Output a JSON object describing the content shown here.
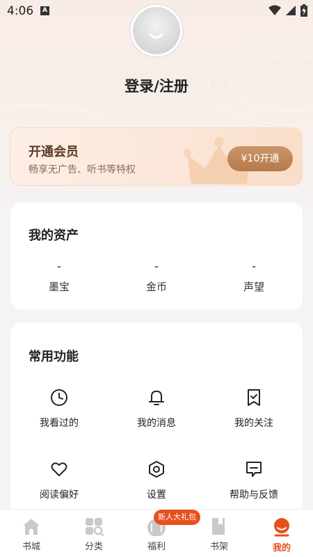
{
  "status_bar": {
    "time": "4:06",
    "notification_icon": "A"
  },
  "profile": {
    "login_label": "登录/注册"
  },
  "vip": {
    "title": "开通会员",
    "subtitle": "畅享无广告、听书等特权",
    "button_label": "¥10开通"
  },
  "assets": {
    "title": "我的资产",
    "items": [
      {
        "value": "-",
        "label": "墨宝"
      },
      {
        "value": "-",
        "label": "金币"
      },
      {
        "value": "-",
        "label": "声望"
      }
    ]
  },
  "functions": {
    "title": "常用功能",
    "items": [
      {
        "label": "我看过的",
        "icon": "clock-icon"
      },
      {
        "label": "我的消息",
        "icon": "bell-icon"
      },
      {
        "label": "我的关注",
        "icon": "bookmark-check-icon"
      },
      {
        "label": "阅读偏好",
        "icon": "heart-icon"
      },
      {
        "label": "设置",
        "icon": "settings-hexagon-icon"
      },
      {
        "label": "帮助与反馈",
        "icon": "feedback-icon"
      }
    ]
  },
  "nav": {
    "items": [
      {
        "label": "书城",
        "icon": "home-icon"
      },
      {
        "label": "分类",
        "icon": "category-icon"
      },
      {
        "label": "福利",
        "icon": "gift-icon"
      },
      {
        "label": "书架",
        "icon": "bookshelf-icon"
      },
      {
        "label": "我的",
        "icon": "profile-icon",
        "active": true
      }
    ],
    "gift_badge": "新人大礼包"
  },
  "colors": {
    "accent": "#e8501e",
    "vip_button": "#b67a49",
    "background": "#f5f3f3"
  }
}
